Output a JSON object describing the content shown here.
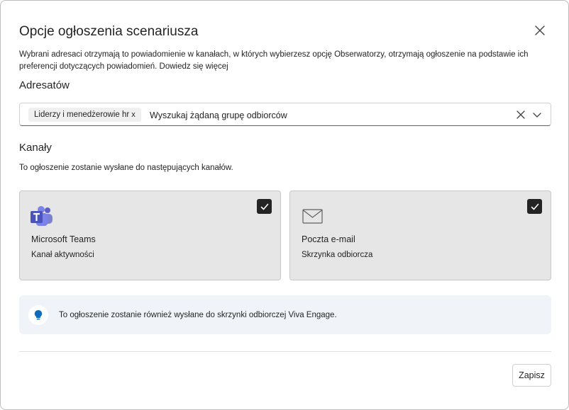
{
  "dialog": {
    "title": "Opcje ogłoszenia scenariusza",
    "description": "Wybrani adresaci otrzymają to powiadomienie w kanałach, w których wybierzesz opcję Obserwatorzy, otrzymają ogłoszenie na podstawie ich preferencji dotyczących powiadomień.",
    "learn_more": "Dowiedz się więcej"
  },
  "recipients": {
    "label": "Adresatów",
    "chip_label": "Liderzy i menedżerowie hr",
    "chip_remove": "x",
    "placeholder": "Wyszukaj żądaną grupę odbiorców"
  },
  "channels": {
    "label": "Kanały",
    "description": "To ogłoszenie zostanie wysłane do następujących kanałów.",
    "items": [
      {
        "name": "Microsoft Teams",
        "sub": "Kanał aktywności",
        "checked": true,
        "icon": "teams-icon"
      },
      {
        "name": "Poczta e-mail",
        "sub": "Skrzynka odbiorcza",
        "checked": true,
        "icon": "mail-icon"
      }
    ]
  },
  "info": {
    "icon": "lightbulb-icon",
    "text": "To ogłoszenie zostanie również wysłane do skrzynki odbiorczej Viva Engage."
  },
  "footer": {
    "save_label": "Zapisz"
  },
  "colors": {
    "teams_purple": "#5b5fc7",
    "info_blue": "#0f6cbd",
    "info_bg": "#f0f4f9",
    "card_bg": "#e6e6e6",
    "check_bg": "#242424"
  }
}
